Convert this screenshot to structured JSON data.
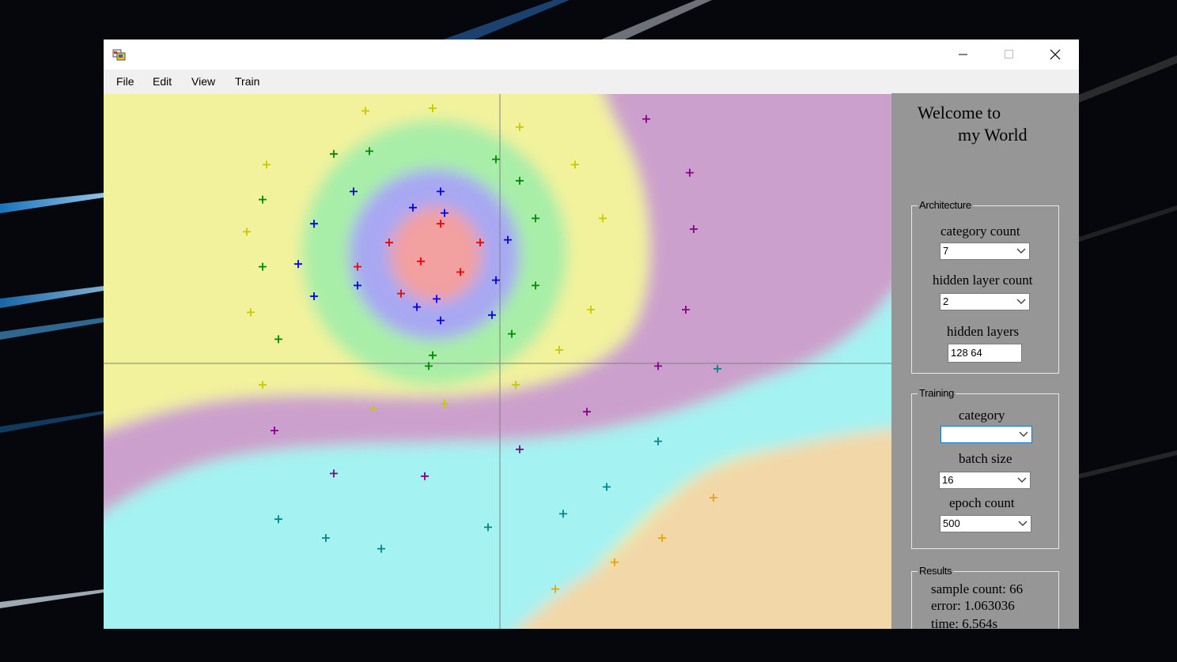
{
  "menu": [
    "File",
    "Edit",
    "View",
    "Train"
  ],
  "panel": {
    "welcome_line1": "Welcome to",
    "welcome_line2": "my World",
    "architecture": {
      "title": "Architecture",
      "category_count_label": "category count",
      "category_count_value": "7",
      "hidden_layer_count_label": "hidden layer count",
      "hidden_layer_count_value": "2",
      "hidden_layers_label": "hidden layers",
      "hidden_layers_value": "128 64"
    },
    "training": {
      "title": "Training",
      "category_label": "category",
      "category_value": "",
      "batch_size_label": "batch size",
      "batch_size_value": "16",
      "epoch_count_label": "epoch count",
      "epoch_count_value": "500"
    },
    "results": {
      "title": "Results",
      "sample_count": "sample count: 66",
      "error": "error: 1.063036",
      "time": "time: 6.564s"
    }
  },
  "colors": {
    "region_red": "#f2a0a0",
    "region_blue": "#a8a8f2",
    "region_green": "#a8eea8",
    "region_yellow": "#f2f29c",
    "region_purple": "#cca0cc",
    "region_cyan": "#a4f2f2",
    "region_orange": "#f2d8a8",
    "sample_red": "#ee0000",
    "sample_blue": "#0000ee",
    "sample_green": "#008800",
    "sample_yellow": "#c8c800",
    "sample_purple": "#880088",
    "sample_cyan": "#008888",
    "sample_orange": "#f0a000"
  },
  "samples": {
    "red": [
      [
        -0.15,
        0.52
      ],
      [
        -0.28,
        0.45
      ],
      [
        -0.05,
        0.45
      ],
      [
        -0.36,
        0.36
      ],
      [
        -0.2,
        0.38
      ],
      [
        -0.1,
        0.34
      ],
      [
        -0.25,
        0.26
      ]
    ],
    "blue": [
      [
        -0.37,
        0.64
      ],
      [
        -0.15,
        0.64
      ],
      [
        -0.22,
        0.58
      ],
      [
        -0.47,
        0.52
      ],
      [
        -0.14,
        0.56
      ],
      [
        -0.16,
        0.24
      ],
      [
        -0.51,
        0.37
      ],
      [
        -0.36,
        0.29
      ],
      [
        -0.47,
        0.25
      ],
      [
        -0.21,
        0.21
      ],
      [
        -0.15,
        0.16
      ],
      [
        -0.01,
        0.31
      ],
      [
        0.02,
        0.46
      ],
      [
        -0.02,
        0.18
      ]
    ],
    "green": [
      [
        -0.42,
        0.78
      ],
      [
        -0.33,
        0.79
      ],
      [
        -0.01,
        0.76
      ],
      [
        0.05,
        0.68
      ],
      [
        -0.6,
        0.61
      ],
      [
        0.09,
        0.54
      ],
      [
        -0.6,
        0.36
      ],
      [
        0.09,
        0.29
      ],
      [
        -0.56,
        0.09
      ],
      [
        0.03,
        0.11
      ],
      [
        -0.17,
        0.03
      ],
      [
        -0.18,
        -0.01
      ]
    ],
    "yellow": [
      [
        -0.34,
        0.94
      ],
      [
        -0.17,
        0.95
      ],
      [
        0.05,
        0.88
      ],
      [
        -0.59,
        0.74
      ],
      [
        0.19,
        0.74
      ],
      [
        -0.64,
        0.49
      ],
      [
        0.26,
        0.54
      ],
      [
        0.23,
        0.2
      ],
      [
        -0.63,
        0.19
      ],
      [
        0.15,
        0.05
      ],
      [
        -0.6,
        -0.08
      ],
      [
        -0.14,
        -0.15
      ],
      [
        -0.32,
        -0.17
      ],
      [
        0.04,
        -0.08
      ]
    ],
    "purple": [
      [
        0.37,
        0.91
      ],
      [
        0.48,
        0.71
      ],
      [
        0.49,
        0.5
      ],
      [
        0.47,
        0.2
      ],
      [
        0.4,
        -0.01
      ],
      [
        0.22,
        -0.18
      ],
      [
        0.05,
        -0.32
      ],
      [
        -0.57,
        -0.25
      ],
      [
        -0.42,
        -0.41
      ],
      [
        -0.19,
        -0.42
      ]
    ],
    "cyan": [
      [
        0.55,
        -0.02
      ],
      [
        0.4,
        -0.29
      ],
      [
        0.27,
        -0.46
      ],
      [
        0.16,
        -0.56
      ],
      [
        -0.03,
        -0.61
      ],
      [
        -0.56,
        -0.58
      ],
      [
        -0.44,
        -0.65
      ],
      [
        -0.3,
        -0.69
      ]
    ],
    "orange": [
      [
        0.54,
        -0.5
      ],
      [
        0.41,
        -0.65
      ],
      [
        0.29,
        -0.74
      ],
      [
        0.14,
        -0.84
      ]
    ]
  }
}
